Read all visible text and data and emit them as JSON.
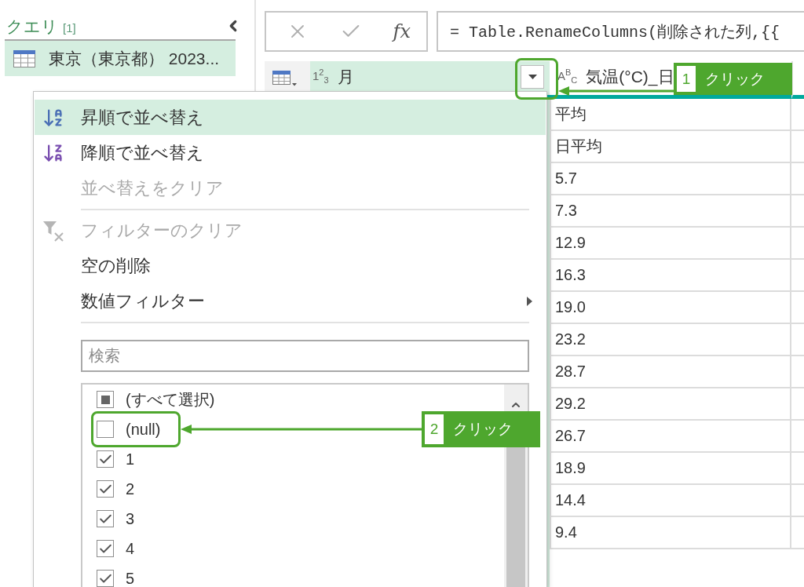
{
  "query_pane": {
    "title": "クエリ",
    "count": "[1]",
    "queries": [
      {
        "name": "東京（東京都） 2023...",
        "selected": true
      }
    ]
  },
  "formula_bar": {
    "fx": "fx",
    "formula": "= Table.RenameColumns(削除された列,{{"
  },
  "columns": [
    {
      "type_label": "1$^{2}$$_{3}$",
      "name": "月",
      "selected": true,
      "filter_button": true
    },
    {
      "type_label": "A$^{B}$$_{C}$",
      "name": "気温(°C)_日",
      "selected": false,
      "values": [
        "平均",
        "日平均",
        "5.7",
        "7.3",
        "12.9",
        "16.3",
        "19.0",
        "23.2",
        "28.7",
        "29.2",
        "26.7",
        "18.9",
        "14.4",
        "9.4"
      ]
    }
  ],
  "filter_menu": {
    "items": [
      {
        "kind": "ascending",
        "label": "昇順で並べ替え",
        "highlighted": true,
        "disabled": false,
        "submenu": false
      },
      {
        "kind": "descending",
        "label": "降順で並べ替え",
        "highlighted": false,
        "disabled": false,
        "submenu": false
      },
      {
        "kind": "plain",
        "label": "並べ替えをクリア",
        "highlighted": false,
        "disabled": true,
        "submenu": false
      },
      {
        "kind": "separator"
      },
      {
        "kind": "clearfilter",
        "label": "フィルターのクリア",
        "highlighted": false,
        "disabled": true,
        "submenu": false
      },
      {
        "kind": "plain",
        "label": "空の削除",
        "highlighted": false,
        "disabled": false,
        "submenu": false
      },
      {
        "kind": "plain",
        "label": "数値フィルター",
        "highlighted": false,
        "disabled": false,
        "submenu": true
      },
      {
        "kind": "separator"
      }
    ],
    "search": {
      "placeholder": "検索"
    },
    "select_all": {
      "label": "(すべて選択)",
      "indeterminate": true
    },
    "values": [
      {
        "label": "(null)",
        "checked": false
      },
      {
        "label": "1",
        "checked": true
      },
      {
        "label": "2",
        "checked": true
      },
      {
        "label": "3",
        "checked": true
      },
      {
        "label": "4",
        "checked": true
      },
      {
        "label": "5",
        "checked": true
      }
    ]
  },
  "callouts": [
    {
      "number": "1",
      "label": "クリック"
    },
    {
      "number": "2",
      "label": "クリック"
    }
  ]
}
